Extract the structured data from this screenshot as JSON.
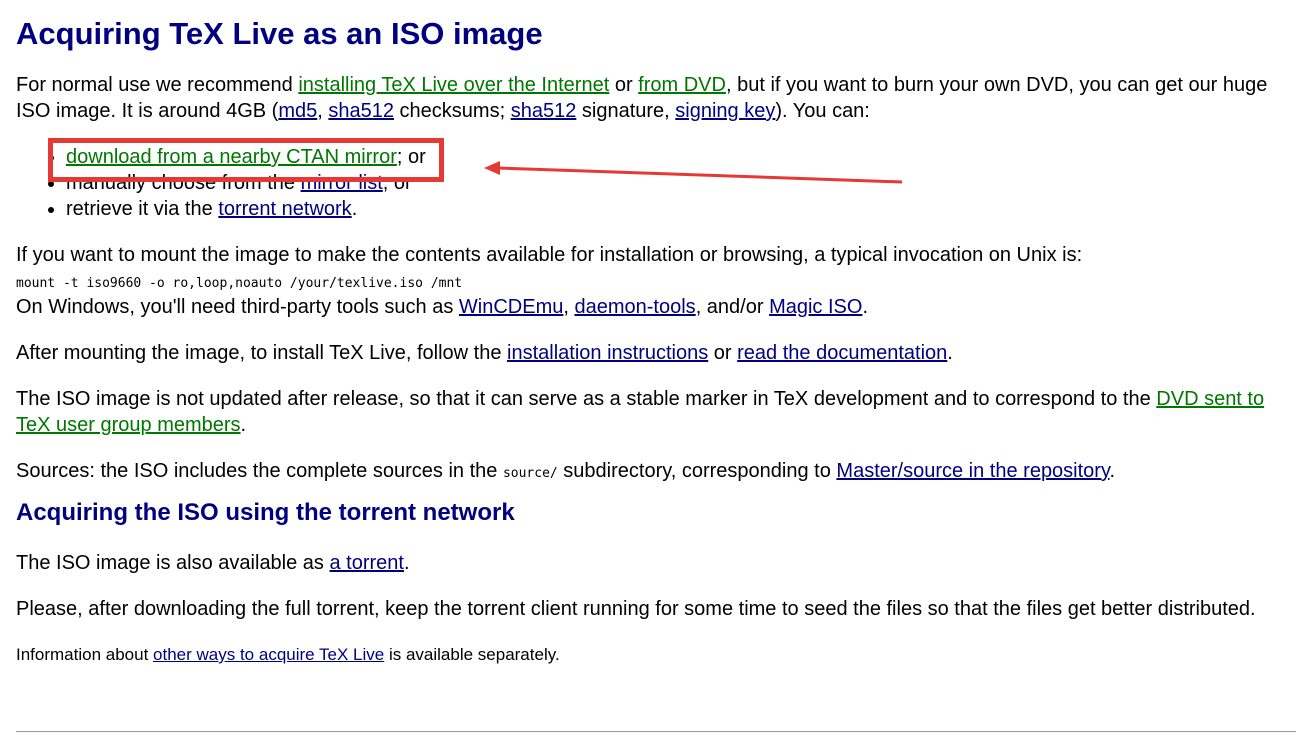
{
  "page": {
    "title": "Acquiring TeX Live as an ISO image",
    "intro": {
      "t1": "For normal use we recommend ",
      "link_internet": "installing TeX Live over the Internet",
      "t2": " or ",
      "link_dvd": "from DVD",
      "t3": ", but if you want to burn your own DVD, you can get our huge ISO image. It is around 4GB (",
      "link_md5": "md5",
      "t4": ", ",
      "link_sha512_a": "sha512",
      "t5": " checksums; ",
      "link_sha512_b": "sha512",
      "t6": " signature, ",
      "link_key": "signing key",
      "t7": "). You can:"
    },
    "list": {
      "item1_link": "download from a nearby CTAN mirror",
      "item1_tail": "; or",
      "item2_text": "manually choose from the ",
      "item2_link": "mirror list",
      "item2_tail": ", or",
      "item3_text": "retrieve it via the ",
      "item3_link": "torrent network",
      "item3_tail": "."
    },
    "mount": {
      "text": "If you want to mount the image to make the contents available for installation or browsing, a typical invocation on Unix is:",
      "command": "mount -t iso9660 -o ro,loop,noauto /your/texlive.iso /mnt",
      "win_text": "On Windows, you'll need third-party tools such as ",
      "link_wincdemu": "WinCDEmu",
      "win_t2": ", ",
      "link_daemon": "daemon-tools",
      "win_t3": ", and/or ",
      "link_magic": "Magic ISO",
      "win_t4": "."
    },
    "after": {
      "t1": "After mounting the image, to install TeX Live, follow the ",
      "link_install": "installation instructions",
      "t2": " or ",
      "link_docs": "read the documentation",
      "t3": "."
    },
    "iso": {
      "t1": "The ISO image is not updated after release, so that it can serve as a stable marker in TeX development and to correspond to the ",
      "link_dvd_tug": "DVD sent to TeX user group members",
      "t2": "."
    },
    "sources": {
      "t1": "Sources: the ISO includes the complete sources in the ",
      "code": "source/",
      "t2": " subdirectory, corresponding to ",
      "link_repo": "Master/source in the repository",
      "t3": "."
    },
    "torrent_heading": "Acquiring the ISO using the torrent network",
    "torrent": {
      "t1": "The ISO image is also available as ",
      "link": "a torrent",
      "t2": "."
    },
    "please": "Please, after downloading the full torrent, keep the torrent client running for some time to seed the files so that the files get better distributed.",
    "info": {
      "t1": "Information about ",
      "link": "other ways to acquire TeX Live",
      "t2": " is available separately."
    }
  },
  "colors": {
    "heading": "#000080",
    "link_visited": "#007700",
    "link": "#000080",
    "highlight": "#e53935"
  }
}
